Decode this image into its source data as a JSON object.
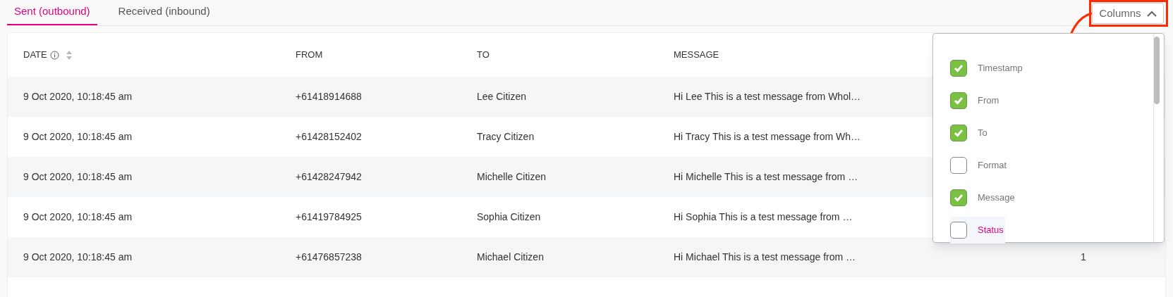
{
  "tabs": [
    {
      "label": "Sent (outbound)",
      "selected": true
    },
    {
      "label": "Received (inbound)",
      "selected": false
    }
  ],
  "columns_button": {
    "label": "Columns",
    "expanded": true
  },
  "table": {
    "columns": [
      {
        "label": "DATE"
      },
      {
        "label": "FROM"
      },
      {
        "label": "TO"
      },
      {
        "label": "MESSAGE"
      }
    ],
    "rows": [
      {
        "date": "9 Oct 2020, 10:18:45 am",
        "from": "+61418914688",
        "to": "Lee Citizen",
        "message": "Hi Lee This is a test message from Whol…"
      },
      {
        "date": "9 Oct 2020, 10:18:45 am",
        "from": "+61428152402",
        "to": "Tracy Citizen",
        "message": "Hi Tracy This is a test message from Wh…"
      },
      {
        "date": "9 Oct 2020, 10:18:45 am",
        "from": "+61428247942",
        "to": "Michelle Citizen",
        "message": "Hi Michelle This is a test message from …"
      },
      {
        "date": "9 Oct 2020, 10:18:45 am",
        "from": "+61419784925",
        "to": "Sophia Citizen",
        "message": "Hi Sophia This is a test message from …"
      },
      {
        "date": "9 Oct 2020, 10:18:45 am",
        "from": "+61476857238",
        "to": "Michael Citizen",
        "message": "Hi Michael This is a test message from …",
        "column_5": "1"
      }
    ]
  },
  "columns_menu": {
    "items": [
      {
        "label": "Timestamp",
        "checked": true,
        "highlighted": false
      },
      {
        "label": "From",
        "checked": true,
        "highlighted": false
      },
      {
        "label": "To",
        "checked": true,
        "highlighted": false
      },
      {
        "label": "Format",
        "checked": false,
        "highlighted": false
      },
      {
        "label": "Message",
        "checked": true,
        "highlighted": false
      },
      {
        "label": "Status",
        "checked": false,
        "highlighted": true
      }
    ]
  }
}
